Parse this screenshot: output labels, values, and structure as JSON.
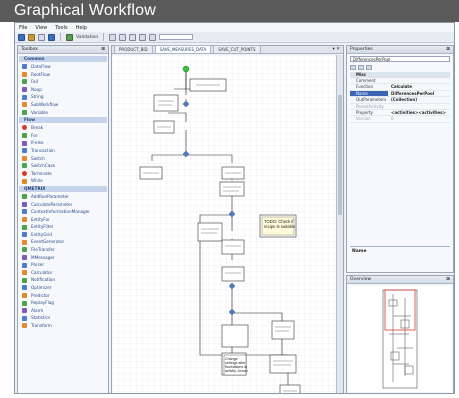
{
  "banner": {
    "title": "Graphical Workflow"
  },
  "menu": [
    "File",
    "View",
    "Tools",
    "Help"
  ],
  "toolbar": {
    "validation_label": "Validation"
  },
  "toolbox": {
    "title": "Toolbox",
    "categories": [
      {
        "name": "Common",
        "items": [
          "DataFlow",
          "RootFlow",
          "Fail",
          "Noop",
          "String",
          "SubWorkflow",
          "Variable"
        ]
      },
      {
        "name": "Flow",
        "items": [
          "Break",
          "For",
          "If-else",
          "Transaction",
          "Switch",
          "SwitchCase",
          "Terminate",
          "While"
        ]
      },
      {
        "name": "QMETRIX",
        "items": [
          "AddRunParameter",
          "CalculateParameter",
          "ContextInformationManager",
          "EntityFor",
          "EntityFilter",
          "EntityGrid",
          "EventGenerator",
          "FileTransfer",
          "MMessager",
          "Parser",
          "Calculator",
          "Notification",
          "Optimizer",
          "Predictor",
          "ReplayFlag",
          "Alarm",
          "Statistics",
          "Transform"
        ]
      }
    ]
  },
  "designer": {
    "tabs": [
      "PRODUCT_BID",
      "SAVE_MEASURES_DATA",
      "SAVE_CUT_POINTS"
    ],
    "active_tab_index": 1,
    "note_text": "TODO: Check if recipe is suitable",
    "change_text": "Change settings after fluctuations in activity. Actual"
  },
  "properties": {
    "title": "Properties",
    "selected_object": "DifferencesPerPool",
    "category": "Misc",
    "rows": [
      {
        "name": "Comment",
        "value": ""
      },
      {
        "name": "Function",
        "value": "Calculate"
      },
      {
        "name": "Name",
        "value": "DifferencesPerPool"
      },
      {
        "name": "OutParameters",
        "value": "(Collection)"
      },
      {
        "name": "ParentActivity",
        "value": ""
      },
      {
        "name": "Property",
        "value": "<activities><activities>"
      },
      {
        "name": "Version",
        "value": "0"
      }
    ],
    "selected_row_index": 2,
    "description_title": "Name"
  },
  "overview": {
    "title": "Overview"
  },
  "colors": {
    "banner_bg": "#5a5a5a",
    "toolbox_category_bg": "#c5d4ea",
    "selection_blue": "#3a64b4",
    "start_node_green": "#3bbf3b"
  }
}
